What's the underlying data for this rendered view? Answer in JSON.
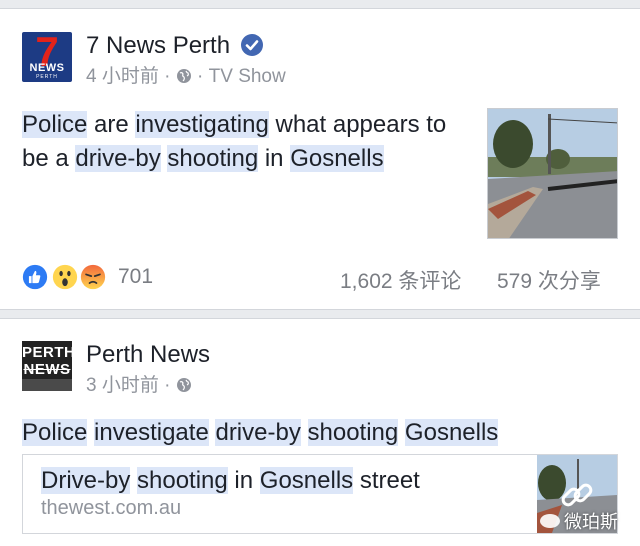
{
  "post1": {
    "page_name": "7 News Perth",
    "logo_text": {
      "brand": "7",
      "word": "NEWS",
      "city": "PERTH"
    },
    "time": "4 小时前",
    "separator": "·",
    "category": "· TV Show",
    "text_parts": [
      "Police",
      " are ",
      "investigating",
      " what appears to",
      "be a ",
      "drive-by",
      " ",
      "shooting",
      " in ",
      "Gosnells"
    ],
    "reaction_count": "701",
    "comments": "1,602 条评论",
    "shares": "579 次分享"
  },
  "post2": {
    "page_name": "Perth News",
    "logo_text": {
      "line1": "PERTH",
      "line2": "NEWS"
    },
    "time": "3 小时前",
    "separator": "·",
    "text_parts": [
      "Police",
      " ",
      "investigate",
      " ",
      "drive-by",
      " ",
      "shooting",
      " ",
      "Gosnells"
    ],
    "link": {
      "title_parts": [
        "Drive-by",
        " ",
        "shooting",
        " in ",
        "Gosnells",
        " street"
      ],
      "domain": "thewest.com.au"
    },
    "watermark": "微珀斯"
  },
  "colors": {
    "highlight": "#dce6f8",
    "verified": "#4267b2",
    "like": "#2d7bf4",
    "reaction_yellow": "#ffd54f",
    "angry": "#f2683c"
  }
}
